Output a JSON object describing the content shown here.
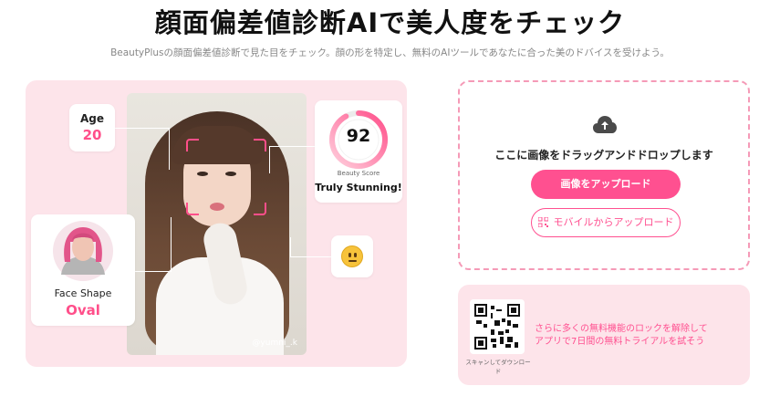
{
  "header": {
    "title": "顔面偏差値診断AIで美人度をチェック",
    "subtitle": "BeautyPlusの顔面偏差値診断で見た目をチェック。顔の形を特定し、無料のAIツールであなたに合った美のドバイスを受けよう。"
  },
  "demo": {
    "age_label": "Age",
    "age_value": "20",
    "face_shape_label": "Face Shape",
    "face_shape_value": "Oval",
    "score_value": "92",
    "score_fraction": 0.92,
    "score_label": "Beauty Score",
    "score_text": "Truly Stunning!",
    "photo_credit": "@yumni_.k",
    "emoji_icon": "neutral-face-icon"
  },
  "upload": {
    "drop_text": "ここに画像をドラッグアンドドロップします",
    "upload_button": "画像をアップロード",
    "mobile_button": "モバイルからアップロード"
  },
  "promo": {
    "qr_caption": "スキャンしてダウンロード",
    "line1": "さらに多くの無料機能のロックを解除して",
    "line2": "アプリで7日間の無料トライアルを試そう"
  },
  "colors": {
    "accent": "#ff5090",
    "panel_pink": "#fde4ea"
  }
}
